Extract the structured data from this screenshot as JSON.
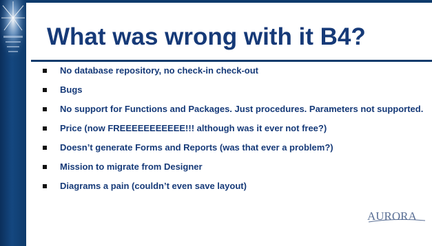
{
  "slide": {
    "title": "What was wrong with it B4?",
    "bullets": [
      "No database repository, no check-in check-out",
      "Bugs",
      "No support for Functions and Packages. Just procedures. Parameters not supported.",
      "Price (now FREEEEEEEEEEE!!! although was it ever not free?)",
      "Doesn’t generate Forms and Reports (was that ever a problem?)",
      "Mission to migrate from Designer",
      "Diagrams a pain (couldn’t even save layout)"
    ],
    "logo_text": "AURORA"
  },
  "colors": {
    "title": "#163a78",
    "band": "#0e3a6b",
    "bullet_marker": "#111111",
    "logo": "#5a6f95"
  }
}
